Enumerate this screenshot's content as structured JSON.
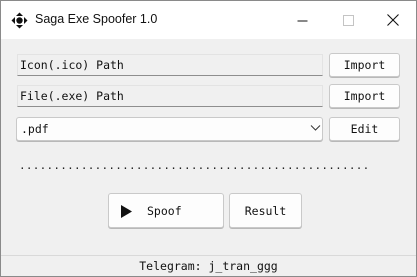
{
  "window": {
    "title": "Saga Exe Spoofer 1.0",
    "app_icon": "gamepad-icon",
    "controls": [
      "minimize-icon",
      "maximize-icon",
      "close-icon"
    ]
  },
  "icon_row": {
    "field_text": "Icon(.ico) Path",
    "button_label": "Import"
  },
  "file_row": {
    "field_text": "File(.exe) Path",
    "button_label": "Import"
  },
  "extension_row": {
    "selected": ".pdf",
    "button_label": "Edit"
  },
  "progress": {
    "text": "...................................................",
    "value": 0
  },
  "actions": {
    "spoof_label": "Spoof",
    "spoof_icon": "play-icon",
    "result_label": "Result"
  },
  "status": {
    "text": "Telegram: j_tran_ggg"
  }
}
